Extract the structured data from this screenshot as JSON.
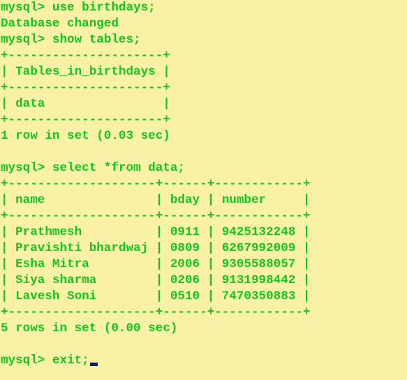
{
  "colors": {
    "background": "#F8F1A6",
    "text": "#12C51F",
    "cursor": "#0A1A5C"
  },
  "lines": [
    "mysql> use birthdays;",
    "Database changed",
    "mysql> show tables;",
    "+---------------------+",
    "| Tables_in_birthdays |",
    "+---------------------+",
    "| data                |",
    "+---------------------+",
    "1 row in set (0.03 sec)",
    "",
    "mysql> select *from data;",
    "+--------------------+------+------------+",
    "| name               | bday | number     |",
    "+--------------------+------+------------+",
    "| Prathmesh          | 0911 | 9425132248 |",
    "| Pravishti bhardwaj | 0809 | 6267992009 |",
    "| Esha Mitra         | 2006 | 9305588057 |",
    "| Siya sharma        | 0206 | 9131998442 |",
    "| Lavesh Soni        | 0510 | 7470350883 |",
    "+--------------------+------+------------+",
    "5 rows in set (0.00 sec)",
    "",
    "mysql> exit;"
  ]
}
